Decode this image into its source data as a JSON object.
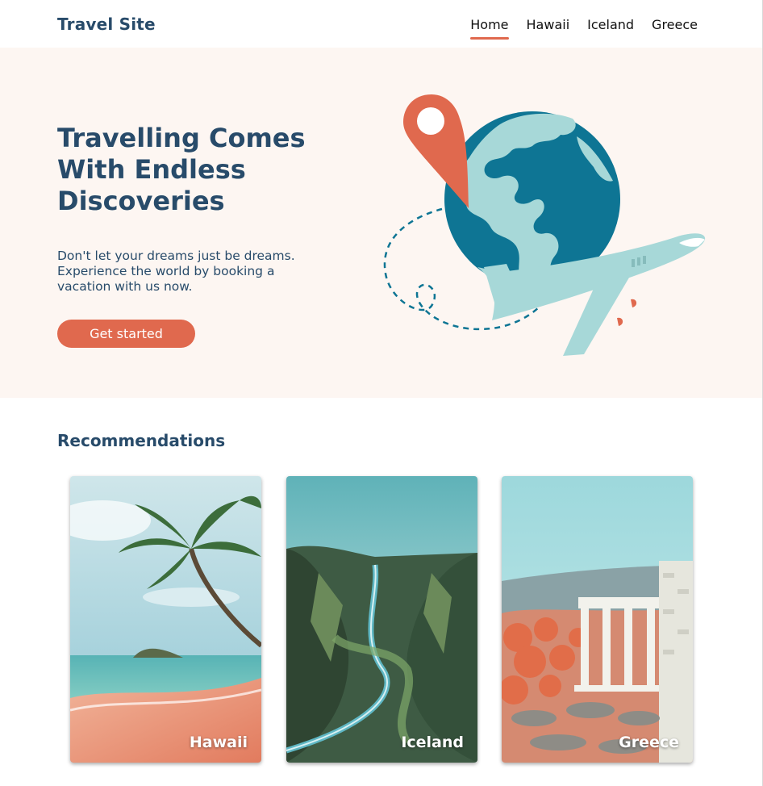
{
  "header": {
    "logo": "Travel Site",
    "nav": [
      {
        "label": "Home",
        "active": true
      },
      {
        "label": "Hawaii",
        "active": false
      },
      {
        "label": "Iceland",
        "active": false
      },
      {
        "label": "Greece",
        "active": false
      }
    ]
  },
  "hero": {
    "title_lines": [
      "Travelling Comes",
      "With Endless",
      "Discoveries"
    ],
    "subtitle_lines": [
      "Don't let your dreams just be dreams.",
      "Experience the world by booking a",
      "vacation with us now."
    ],
    "cta_label": "Get started",
    "illustration_icons": [
      "globe-icon",
      "location-pin-icon",
      "airplane-icon"
    ]
  },
  "recommendations": {
    "title": "Recommendations",
    "cards": [
      {
        "label": "Hawaii"
      },
      {
        "label": "Iceland"
      },
      {
        "label": "Greece"
      }
    ]
  },
  "colors": {
    "brand": "#284b6a",
    "accent": "#e0694e",
    "hero_bg": "#fdf6f2",
    "globe": "#0e7594",
    "land": "#a7d8d8"
  }
}
